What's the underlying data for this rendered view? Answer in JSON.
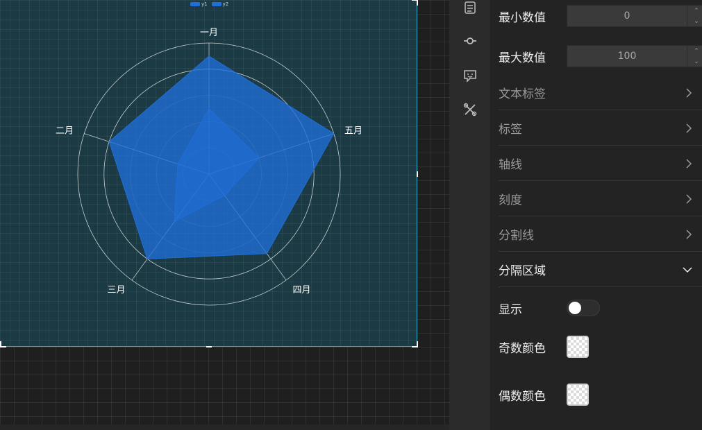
{
  "chart_data": {
    "type": "radar",
    "indicators": [
      "一月",
      "五月",
      "四月",
      "三月",
      "二月"
    ],
    "max": 100,
    "min": 0,
    "split_number": 5,
    "series": [
      {
        "name": "y1",
        "values": [
          90,
          100,
          75,
          80,
          80
        ]
      },
      {
        "name": "y2",
        "values": [
          50,
          40,
          20,
          45,
          25
        ]
      }
    ],
    "colors": [
      "#1f6fd8",
      "#1f6fd8"
    ]
  },
  "legend": [
    "y1",
    "y2"
  ],
  "props": {
    "min_label": "最小数值",
    "min_value": "0",
    "max_label": "最大数值",
    "max_value": "100",
    "sections": [
      {
        "label": "文本标签",
        "expanded": false
      },
      {
        "label": "标签",
        "expanded": false
      },
      {
        "label": "轴线",
        "expanded": false
      },
      {
        "label": "刻度",
        "expanded": false
      },
      {
        "label": "分割线",
        "expanded": false
      },
      {
        "label": "分隔区域",
        "expanded": true
      }
    ],
    "show_label": "显示",
    "show_enabled": false,
    "odd_color_label": "奇数颜色",
    "even_color_label": "偶数颜色"
  },
  "tools": [
    "list-icon",
    "commit-icon",
    "chat-icon",
    "tools-icon"
  ]
}
